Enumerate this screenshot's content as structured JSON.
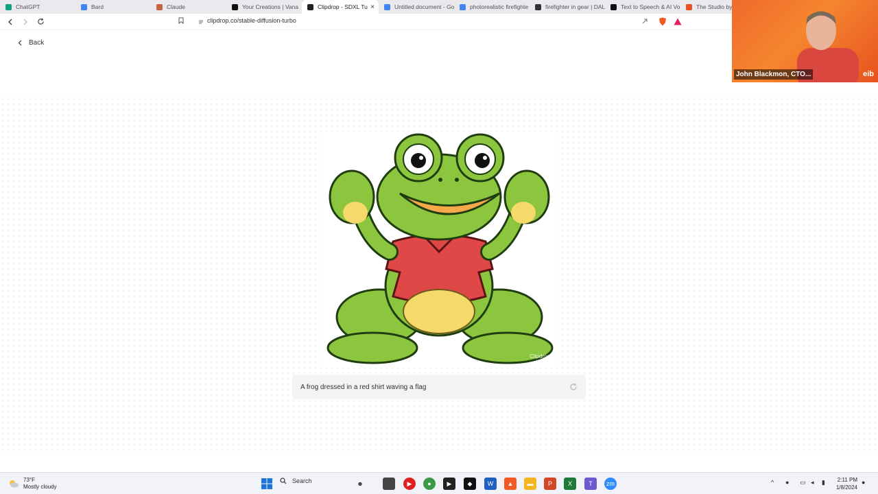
{
  "browser": {
    "tabs": [
      {
        "label": "ChatGPT",
        "color": "#10a37f"
      },
      {
        "label": "Bard",
        "color": "#4285f4"
      },
      {
        "label": "Claude",
        "color": "#c96442"
      },
      {
        "label": "Your Creations | Vana",
        "color": "#111111"
      },
      {
        "label": "Clipdrop - SDXL Tu",
        "color": "#222222",
        "active": true
      },
      {
        "label": "Untitled document - Go",
        "color": "#4285f4"
      },
      {
        "label": "photorealistic firefighte",
        "color": "#4285f4"
      },
      {
        "label": "firefighter in gear | DAL",
        "color": "#333333"
      },
      {
        "label": "Text to Speech & AI Voi",
        "color": "#111111"
      },
      {
        "label": "The Studio by E",
        "color": "#e8531f"
      }
    ],
    "url": "clipdrop.co/stable-diffusion-turbo"
  },
  "page": {
    "back_label": "Back",
    "prompt_value": "A frog dressed in a red shirt waving a flag",
    "watermark": "Clipdrop"
  },
  "video": {
    "participant_name": "John Blackmon, CTO...",
    "logo": "eib"
  },
  "taskbar": {
    "temperature": "73°F",
    "weather": "Mostly cloudy",
    "search_label": "Search",
    "time": "2:11 PM",
    "date": "1/8/2024"
  }
}
